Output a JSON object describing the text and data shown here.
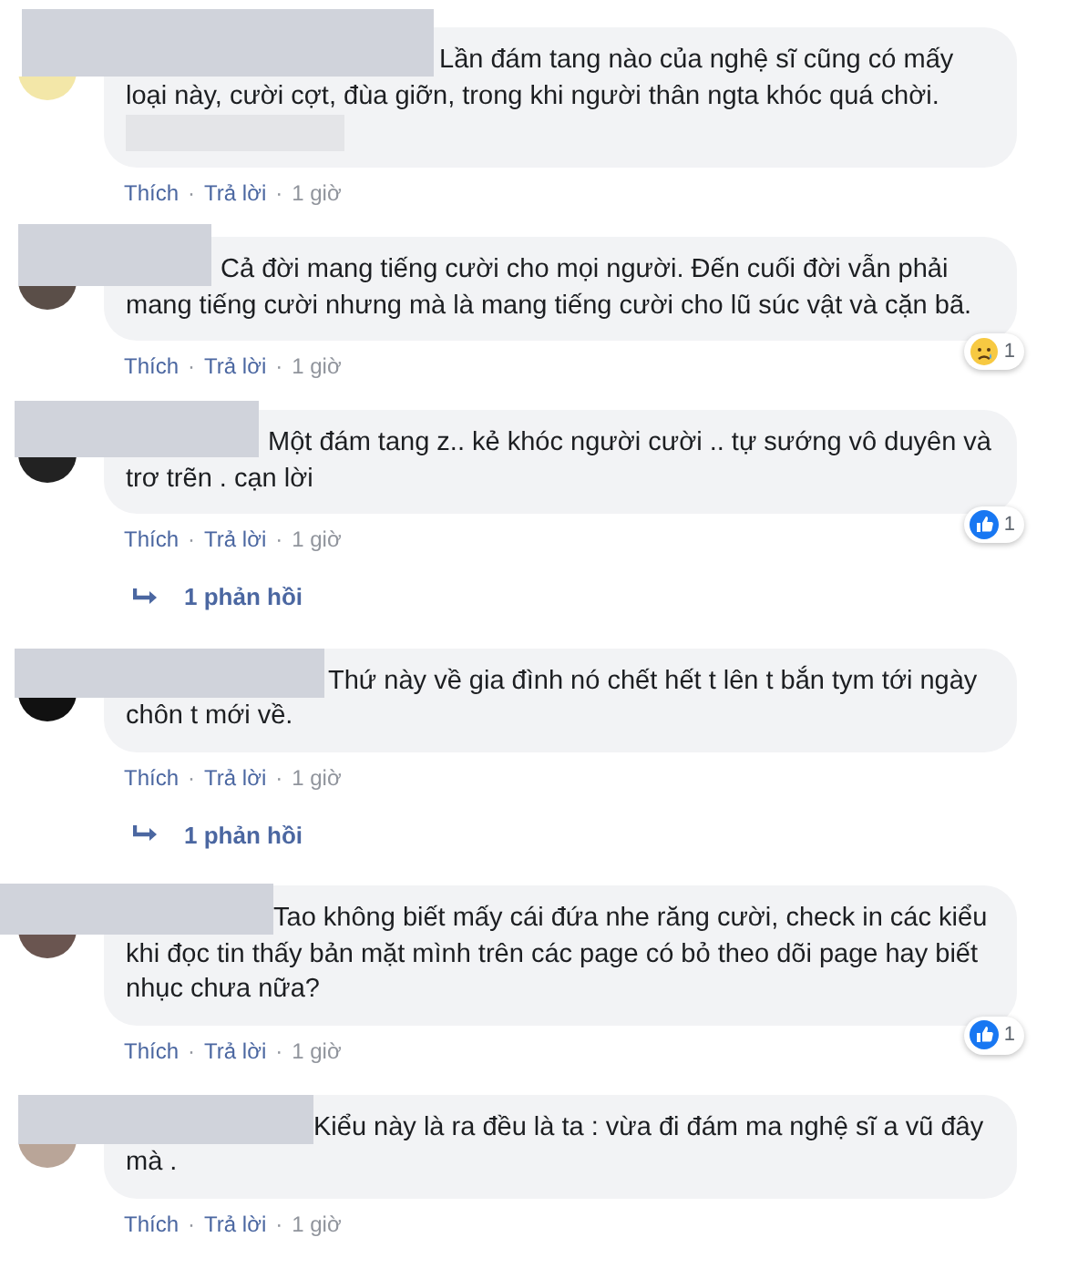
{
  "comments": [
    {
      "text": "Lần đám tang nào của nghệ sĩ cũng có mấy loại này, cười cợt, đùa giỡn, trong khi người thân ngta khóc quá chời.",
      "actions": [
        {
          "kind": "link",
          "text": "Thích"
        },
        {
          "kind": "separator",
          "text": "·"
        },
        {
          "kind": "link",
          "text": "Trả lời"
        },
        {
          "kind": "separator",
          "text": "·"
        },
        {
          "kind": "time",
          "text": "1 giờ"
        }
      ]
    },
    {
      "text": "Cả đời mang tiếng cười cho mọi người. Đến cuối đời vẫn phải mang tiếng cười nhưng mà là mang tiếng cười cho lũ súc vật và cặn bã.",
      "reaction": {
        "kind": "sad",
        "count": "1"
      },
      "actions": [
        {
          "kind": "link",
          "text": "Thích"
        },
        {
          "kind": "separator",
          "text": "·"
        },
        {
          "kind": "link",
          "text": "Trả lời"
        },
        {
          "kind": "separator",
          "text": "·"
        },
        {
          "kind": "time",
          "text": "1 giờ"
        }
      ]
    },
    {
      "text": "Một đám tang z.. kẻ khóc người cười .. tự sướng vô duyên và trơ trẽn . cạn lời",
      "reaction": {
        "kind": "like",
        "count": "1"
      },
      "actions": [
        {
          "kind": "link",
          "text": "Thích"
        },
        {
          "kind": "separator",
          "text": "·"
        },
        {
          "kind": "link",
          "text": "Trả lời"
        },
        {
          "kind": "separator",
          "text": "·"
        },
        {
          "kind": "time",
          "text": "1 giờ"
        }
      ],
      "replies": "1 phản hồi"
    },
    {
      "text": "Thứ này về gia đình nó chết hết t lên t bắn tym tới ngày chôn t mới về.",
      "actions": [
        {
          "kind": "link",
          "text": "Thích"
        },
        {
          "kind": "separator",
          "text": "·"
        },
        {
          "kind": "link",
          "text": "Trả lời"
        },
        {
          "kind": "separator",
          "text": "·"
        },
        {
          "kind": "time",
          "text": "1 giờ"
        }
      ],
      "replies": "1 phản hồi"
    },
    {
      "text": "Tao không biết mấy cái đứa nhe răng cười, check in các kiểu khi đọc tin thấy bản mặt mình trên các page có bỏ theo dõi page hay biết nhục chưa nữa?",
      "reaction": {
        "kind": "like",
        "count": "1"
      },
      "actions": [
        {
          "kind": "link",
          "text": "Thích"
        },
        {
          "kind": "separator",
          "text": "·"
        },
        {
          "kind": "link",
          "text": "Trả lời"
        },
        {
          "kind": "separator",
          "text": "·"
        },
        {
          "kind": "time",
          "text": "1 giờ"
        }
      ]
    },
    {
      "text": "Kiểu này là ra đều là ta : vừa đi đám ma nghệ sĩ a vũ đây mà .",
      "actions": [
        {
          "kind": "link",
          "text": "Thích"
        },
        {
          "kind": "separator",
          "text": "·"
        },
        {
          "kind": "link",
          "text": "Trả lời"
        },
        {
          "kind": "separator",
          "text": "·"
        },
        {
          "kind": "time",
          "text": "1 giờ"
        }
      ]
    }
  ]
}
